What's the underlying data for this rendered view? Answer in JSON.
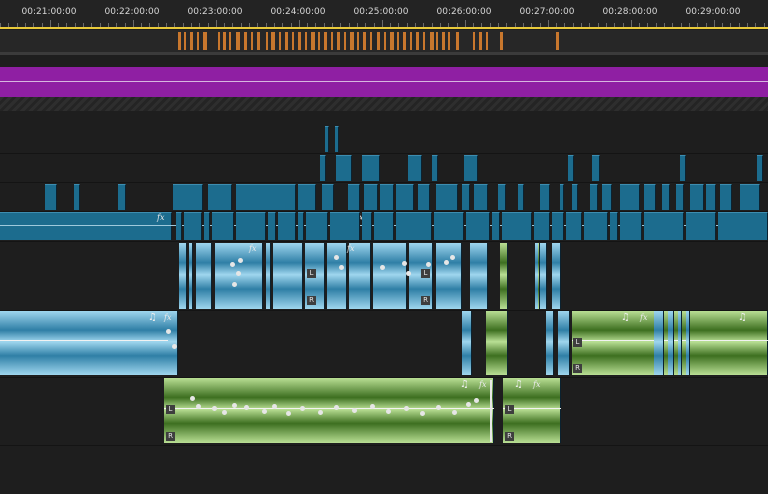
{
  "ruler": {
    "timecodes": [
      "00:21:00:00",
      "00:22:00:00",
      "00:23:00:00",
      "00:24:00:00",
      "00:25:00:00",
      "00:26:00:00",
      "00:27:00:00",
      "00:28:00:00",
      "00:29:00:00"
    ]
  },
  "badges": {
    "left": "L",
    "right": "R"
  },
  "labels": {
    "fx": "fx",
    "music": "♫"
  },
  "colors": {
    "video": "#1c6c8e",
    "audio_blue": "#5ab3d8",
    "audio_green": "#8fc46a",
    "markers": "#c8772d",
    "adjustment": "#8f1fa3",
    "playhead_bar": "#e8c93a"
  }
}
